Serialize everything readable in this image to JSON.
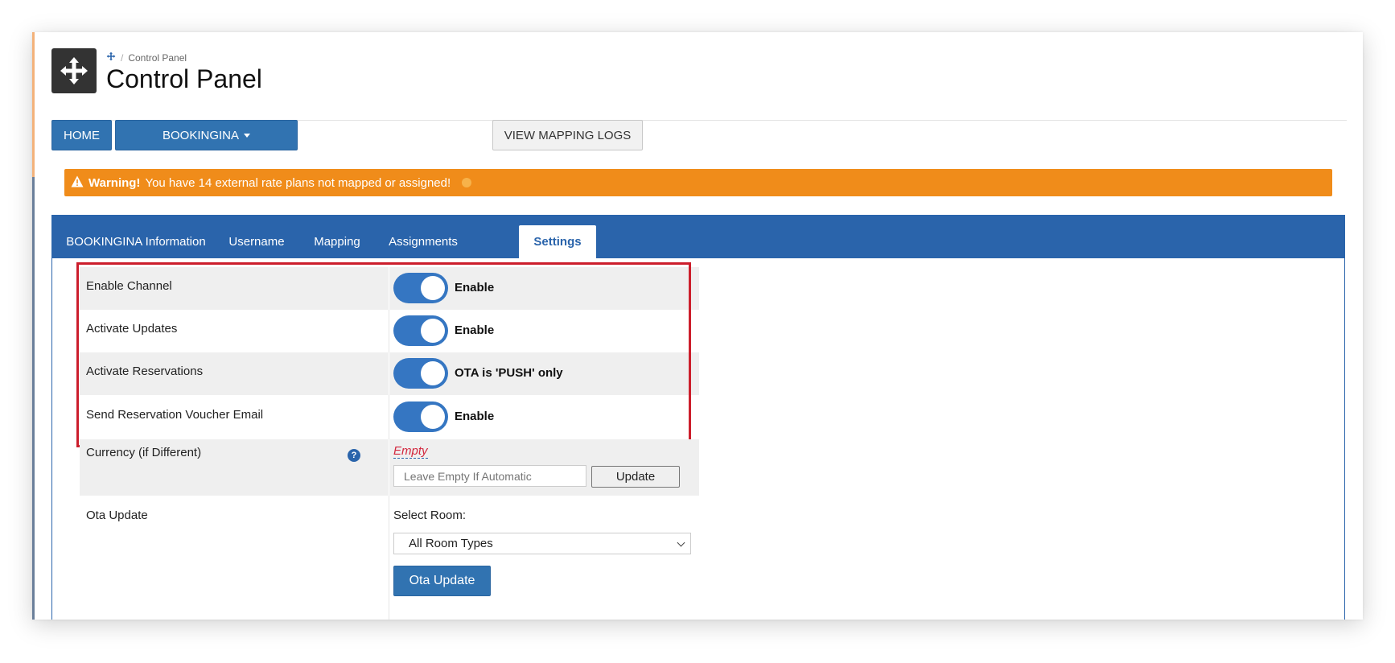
{
  "header": {
    "breadcrumb": "Control Panel",
    "title": "Control Panel"
  },
  "toolbar": {
    "home_label": "HOME",
    "channel_label": "BOOKINGINA",
    "logs_label": "VIEW MAPPING LOGS"
  },
  "warning": {
    "strong": "Warning!",
    "message": "You have 14 external rate plans not mapped or assigned!"
  },
  "tabs": [
    {
      "label": "BOOKINGINA Information"
    },
    {
      "label": "Username"
    },
    {
      "label": "Mapping"
    },
    {
      "label": "Assignments"
    },
    {
      "label": "Settings"
    }
  ],
  "settings": {
    "rows": [
      {
        "label": "Enable Channel",
        "status": "Enable",
        "on": true
      },
      {
        "label": "Activate Updates",
        "status": "Enable",
        "on": true
      },
      {
        "label": "Activate Reservations",
        "status": "OTA is 'PUSH' only",
        "on": true
      },
      {
        "label": "Send Reservation Voucher Email",
        "status": "Enable",
        "on": true
      }
    ],
    "currency": {
      "label": "Currency (if Different)",
      "help": "?",
      "value": "Empty",
      "placeholder": "Leave Empty If Automatic",
      "button": "Update"
    },
    "ota": {
      "label": "Ota Update",
      "select_label": "Select Room:",
      "selected_room": "All Room Types",
      "button": "Ota Update"
    }
  },
  "colors": {
    "primary": "#3173b1",
    "tabbar": "#2a64ab",
    "warning": "#f08c1a",
    "highlight": "#cc1e2c"
  }
}
